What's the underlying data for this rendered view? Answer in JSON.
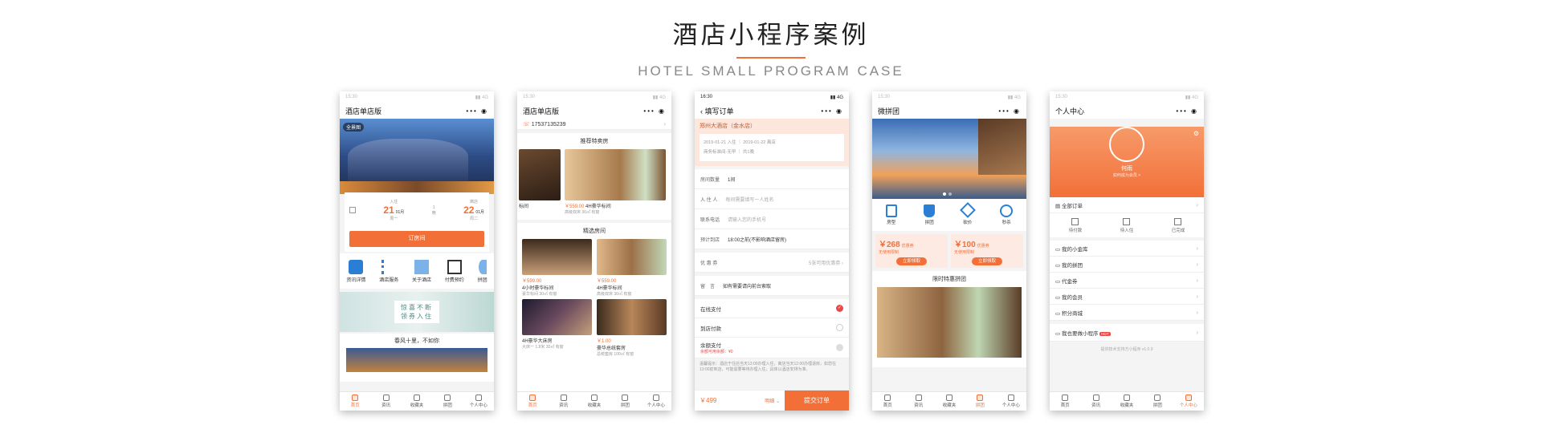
{
  "heading": {
    "title": "酒店小程序案例",
    "subtitle": "HOTEL SMALL PROGRAM CASE"
  },
  "status": {
    "time_faded": "15:30",
    "time": "16:30",
    "signal": "4G"
  },
  "tabs5": [
    "首页",
    "资讯",
    "收藏夹",
    "拼团",
    "个人中心"
  ],
  "p1": {
    "title": "酒店单店版",
    "pano": "全景图",
    "checkin_label": "入住",
    "checkin_day": "21",
    "checkin_month": "01月",
    "checkin_week": "周一",
    "nights": "1",
    "night_unit": "晚",
    "checkout_label": "离店",
    "checkout_day": "22",
    "checkout_month": "01月",
    "checkout_week": "周二",
    "book_btn": "订房间",
    "features": [
      "资讯详情",
      "酒店服务",
      "关于酒店",
      "付费预约",
      "拼团"
    ],
    "banner_line1": "惊喜不断",
    "banner_line2": "领券入住",
    "section": "春风十里，不如你"
  },
  "p2": {
    "title": "酒店单店版",
    "phone": "17537135239",
    "sec1": "推荐特卖房",
    "r1_name": "标间",
    "r2_price": "￥559.00",
    "r2_name": "4H豪华标间",
    "r2_desc": "高级双床 30㎡ 有窗",
    "sec2": "精选房间",
    "g": [
      {
        "price": "￥599.00",
        "name": "4小时豪华标间",
        "desc": "豪华标间 30㎡ 有窗"
      },
      {
        "price": "￥559.00",
        "name": "4H豪华标间",
        "desc": "高级双床 30㎡ 有窗"
      },
      {
        "price": "",
        "name": "4H豪华大床房",
        "desc": "大床一 1.8米 30㎡ 有窗"
      },
      {
        "price": "￥1.00",
        "name": "豪华总统套房",
        "desc": "总统套房 100㎡ 有窗"
      }
    ]
  },
  "p3": {
    "title": "填写订单",
    "hotel": "郑州大酒店（金水店）",
    "dates": "2019-01-21 入住 ｜ 2019-01-22 离店",
    "room": "商务标准间-无早 ｜ 共1晚",
    "fields": [
      {
        "label": "房间数量",
        "value": "1间"
      },
      {
        "label": "入 住 人",
        "value": "每间需要填写一人姓名"
      },
      {
        "label": "联系电话",
        "value": "请输入您的手机号"
      },
      {
        "label": "预计到店",
        "value": "18:00之前(不影响酒店留房)"
      }
    ],
    "coupon_label": "优 惠 券",
    "coupon_value": "5张可用优惠券",
    "remark_label": "留　言",
    "remark_value": "如有需要请向前台索取",
    "pay": [
      "在线支付",
      "到店付款",
      "余额支付"
    ],
    "balance_note": "余额可用余额：¥0",
    "notice": "温馨提示：酒店于住店当天13:00办理入住，离店当天12:00办理退房，如您在13:00前到店，可能需要等待办理入住，具体以酒店安排为准。",
    "total": "￥499",
    "detail": "明细",
    "submit": "提交订单"
  },
  "p4": {
    "title": "微拼团",
    "icons": [
      "房型",
      "拼团",
      "砍价",
      "秒杀"
    ],
    "coupons": [
      {
        "amount": "￥268",
        "tag": "优惠券",
        "desc": "无使用限制",
        "btn": "立即领取"
      },
      {
        "amount": "￥100",
        "tag": "优惠券",
        "desc": "无使用限制",
        "btn": "立即领取"
      }
    ],
    "section": "限时特惠拼团"
  },
  "p5": {
    "title": "个人中心",
    "user": "何雨",
    "level": "如何成为会员 >",
    "orders_title": "全部订单",
    "orders": [
      "待付款",
      "待入住",
      "已完成"
    ],
    "menu": [
      "我的小金库",
      "我的拼团",
      "代金券",
      "我的会员",
      "积分商城",
      "我也要做小程序"
    ],
    "hot": "HOT",
    "footer": "提供技术支持方小程序 v1.0.9"
  },
  "colors": {
    "accent": "#f27038",
    "tab_active": "#f27038"
  }
}
